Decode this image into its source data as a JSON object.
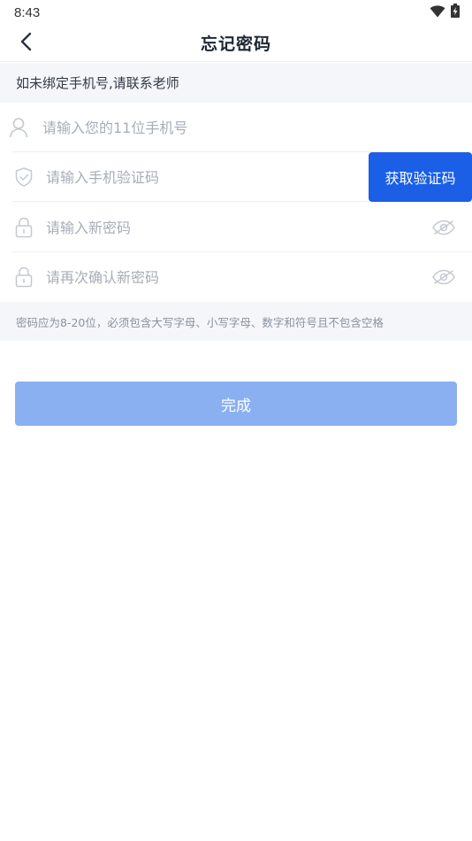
{
  "status_bar": {
    "time": "8:43",
    "icons": [
      "wifi-icon",
      "battery-charging-icon"
    ]
  },
  "header": {
    "title": "忘记密码",
    "back_icon": "chevron-left-icon"
  },
  "notice": {
    "text": "如未绑定手机号,请联系老师"
  },
  "form": {
    "phone": {
      "placeholder": "请输入您的11位手机号",
      "value": "",
      "icon": "user-icon"
    },
    "code": {
      "placeholder": "请输入手机验证码",
      "value": "",
      "icon": "shield-check-icon",
      "button_label": "获取验证码"
    },
    "new_password": {
      "placeholder": "请输入新密码",
      "value": "",
      "icon": "lock-icon",
      "toggle_icon": "eye-off-icon"
    },
    "confirm_password": {
      "placeholder": "请再次确认新密码",
      "value": "",
      "icon": "lock-icon",
      "toggle_icon": "eye-off-icon"
    }
  },
  "hint": {
    "text": "密码应为8-20位，必须包含大写字母、小写字母、数字和符号且不包含空格"
  },
  "submit": {
    "label": "完成"
  },
  "colors": {
    "accent": "#1b5fe6",
    "submit_disabled": "#8ab0f2",
    "notice_bg": "#f4f6fa",
    "placeholder": "#a7adb7"
  }
}
